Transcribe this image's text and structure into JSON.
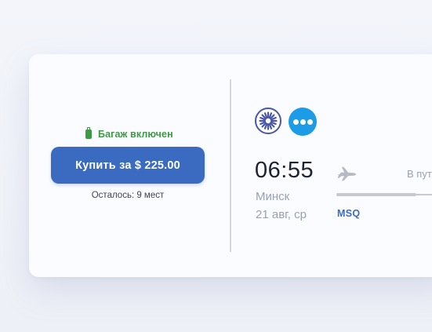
{
  "offer": {
    "baggage_label": "Багаж включен",
    "buy_label": "Купить за $ 225.00",
    "seats_left": "Осталось: 9 мест"
  },
  "flight": {
    "airline_logos": [
      "cornflower-logo",
      "dots-logo"
    ],
    "departure_time": "06:55",
    "departure_city": "Минск",
    "departure_date": "21 авг, ср",
    "departure_airport": "MSQ",
    "in_transit_label": "В пут"
  },
  "colors": {
    "accent": "#3a6bc1",
    "baggage_green": "#3d9a44",
    "muted_text": "#9aa0ad",
    "airline_blue": "#1c9be6"
  }
}
